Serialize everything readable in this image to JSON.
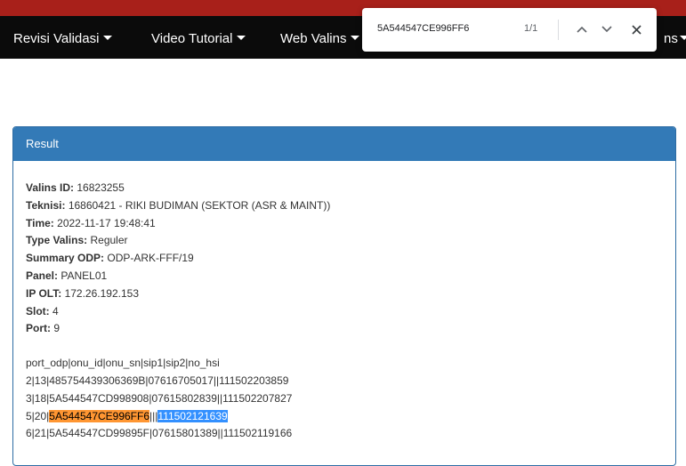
{
  "nav": {
    "items": [
      "Revisi Validasi",
      "Video Tutorial",
      "Web Valins",
      "ns"
    ]
  },
  "find": {
    "query": "5A544547CE996FF6",
    "count": "1/1"
  },
  "panel": {
    "title": "Result"
  },
  "result": {
    "valins_id_label": "Valins ID:",
    "valins_id": "16823255",
    "teknisi_label": "Teknisi:",
    "teknisi": "16860421 - RIKI BUDIMAN (SEKTOR (ASR & MAINT))",
    "time_label": "Time:",
    "time": "2022-11-17 19:48:41",
    "type_label": "Type Valins:",
    "type": "Reguler",
    "summary_label": "Summary ODP:",
    "summary": "ODP-ARK-FFF/19",
    "panel_label": "Panel:",
    "panel": "PANEL01",
    "ip_label": "IP OLT:",
    "ip": "172.26.192.153",
    "slot_label": "Slot:",
    "slot": "4",
    "port_label": "Port:",
    "port": "9"
  },
  "table": {
    "header": "port_odp|onu_id|onu_sn|sip1|sip2|no_hsi",
    "row1": "2|13|485754439306369B|07616705017||111502203859",
    "row2": "3|18|5A544547CD998908|07615802839||111502207827",
    "row3_prefix": "5|20|",
    "row3_match": "5A544547CE996FF6",
    "row3_middle": "|||",
    "row3_selected": "111502121639",
    "row4": "6|21|5A544547CD99895F|07615801389||111502119166"
  },
  "colors": {
    "navbar": "#0b0b0b",
    "top_strip": "#a8201a",
    "panel_heading": "#337ab7",
    "find_match": "#ff9632",
    "selection": "#3390ff"
  },
  "icons": [
    "chevron-up-icon",
    "chevron-down-icon",
    "close-icon",
    "caret-down-icon"
  ]
}
